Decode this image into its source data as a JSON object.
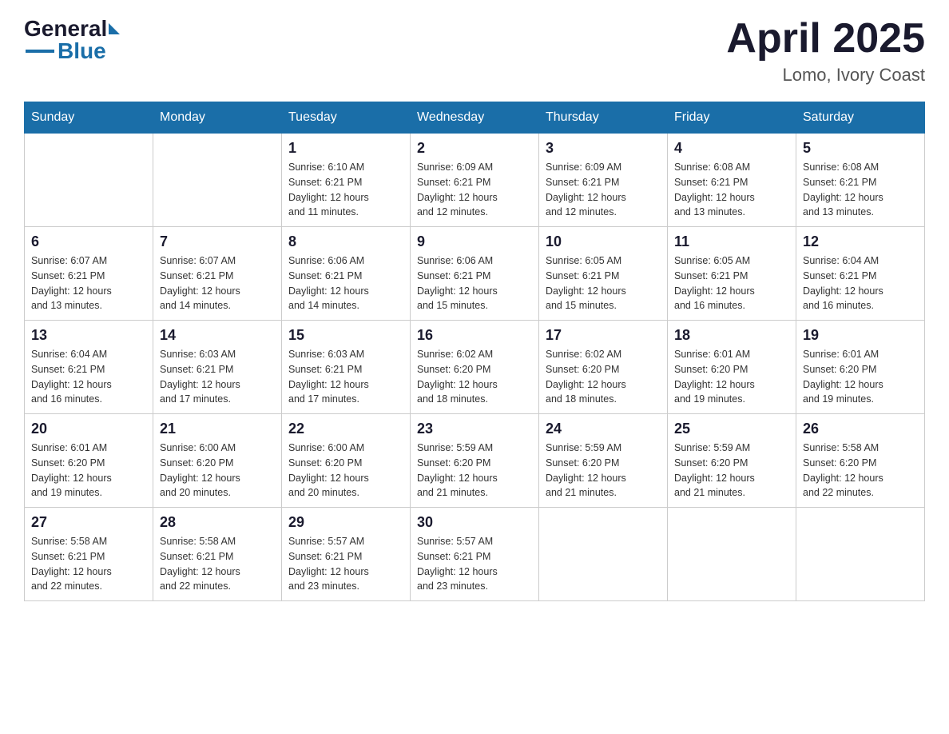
{
  "header": {
    "logo": {
      "general": "General",
      "blue": "Blue"
    },
    "title": "April 2025",
    "location": "Lomo, Ivory Coast"
  },
  "weekdays": [
    "Sunday",
    "Monday",
    "Tuesday",
    "Wednesday",
    "Thursday",
    "Friday",
    "Saturday"
  ],
  "weeks": [
    [
      {
        "day": "",
        "info": ""
      },
      {
        "day": "",
        "info": ""
      },
      {
        "day": "1",
        "info": "Sunrise: 6:10 AM\nSunset: 6:21 PM\nDaylight: 12 hours\nand 11 minutes."
      },
      {
        "day": "2",
        "info": "Sunrise: 6:09 AM\nSunset: 6:21 PM\nDaylight: 12 hours\nand 12 minutes."
      },
      {
        "day": "3",
        "info": "Sunrise: 6:09 AM\nSunset: 6:21 PM\nDaylight: 12 hours\nand 12 minutes."
      },
      {
        "day": "4",
        "info": "Sunrise: 6:08 AM\nSunset: 6:21 PM\nDaylight: 12 hours\nand 13 minutes."
      },
      {
        "day": "5",
        "info": "Sunrise: 6:08 AM\nSunset: 6:21 PM\nDaylight: 12 hours\nand 13 minutes."
      }
    ],
    [
      {
        "day": "6",
        "info": "Sunrise: 6:07 AM\nSunset: 6:21 PM\nDaylight: 12 hours\nand 13 minutes."
      },
      {
        "day": "7",
        "info": "Sunrise: 6:07 AM\nSunset: 6:21 PM\nDaylight: 12 hours\nand 14 minutes."
      },
      {
        "day": "8",
        "info": "Sunrise: 6:06 AM\nSunset: 6:21 PM\nDaylight: 12 hours\nand 14 minutes."
      },
      {
        "day": "9",
        "info": "Sunrise: 6:06 AM\nSunset: 6:21 PM\nDaylight: 12 hours\nand 15 minutes."
      },
      {
        "day": "10",
        "info": "Sunrise: 6:05 AM\nSunset: 6:21 PM\nDaylight: 12 hours\nand 15 minutes."
      },
      {
        "day": "11",
        "info": "Sunrise: 6:05 AM\nSunset: 6:21 PM\nDaylight: 12 hours\nand 16 minutes."
      },
      {
        "day": "12",
        "info": "Sunrise: 6:04 AM\nSunset: 6:21 PM\nDaylight: 12 hours\nand 16 minutes."
      }
    ],
    [
      {
        "day": "13",
        "info": "Sunrise: 6:04 AM\nSunset: 6:21 PM\nDaylight: 12 hours\nand 16 minutes."
      },
      {
        "day": "14",
        "info": "Sunrise: 6:03 AM\nSunset: 6:21 PM\nDaylight: 12 hours\nand 17 minutes."
      },
      {
        "day": "15",
        "info": "Sunrise: 6:03 AM\nSunset: 6:21 PM\nDaylight: 12 hours\nand 17 minutes."
      },
      {
        "day": "16",
        "info": "Sunrise: 6:02 AM\nSunset: 6:20 PM\nDaylight: 12 hours\nand 18 minutes."
      },
      {
        "day": "17",
        "info": "Sunrise: 6:02 AM\nSunset: 6:20 PM\nDaylight: 12 hours\nand 18 minutes."
      },
      {
        "day": "18",
        "info": "Sunrise: 6:01 AM\nSunset: 6:20 PM\nDaylight: 12 hours\nand 19 minutes."
      },
      {
        "day": "19",
        "info": "Sunrise: 6:01 AM\nSunset: 6:20 PM\nDaylight: 12 hours\nand 19 minutes."
      }
    ],
    [
      {
        "day": "20",
        "info": "Sunrise: 6:01 AM\nSunset: 6:20 PM\nDaylight: 12 hours\nand 19 minutes."
      },
      {
        "day": "21",
        "info": "Sunrise: 6:00 AM\nSunset: 6:20 PM\nDaylight: 12 hours\nand 20 minutes."
      },
      {
        "day": "22",
        "info": "Sunrise: 6:00 AM\nSunset: 6:20 PM\nDaylight: 12 hours\nand 20 minutes."
      },
      {
        "day": "23",
        "info": "Sunrise: 5:59 AM\nSunset: 6:20 PM\nDaylight: 12 hours\nand 21 minutes."
      },
      {
        "day": "24",
        "info": "Sunrise: 5:59 AM\nSunset: 6:20 PM\nDaylight: 12 hours\nand 21 minutes."
      },
      {
        "day": "25",
        "info": "Sunrise: 5:59 AM\nSunset: 6:20 PM\nDaylight: 12 hours\nand 21 minutes."
      },
      {
        "day": "26",
        "info": "Sunrise: 5:58 AM\nSunset: 6:20 PM\nDaylight: 12 hours\nand 22 minutes."
      }
    ],
    [
      {
        "day": "27",
        "info": "Sunrise: 5:58 AM\nSunset: 6:21 PM\nDaylight: 12 hours\nand 22 minutes."
      },
      {
        "day": "28",
        "info": "Sunrise: 5:58 AM\nSunset: 6:21 PM\nDaylight: 12 hours\nand 22 minutes."
      },
      {
        "day": "29",
        "info": "Sunrise: 5:57 AM\nSunset: 6:21 PM\nDaylight: 12 hours\nand 23 minutes."
      },
      {
        "day": "30",
        "info": "Sunrise: 5:57 AM\nSunset: 6:21 PM\nDaylight: 12 hours\nand 23 minutes."
      },
      {
        "day": "",
        "info": ""
      },
      {
        "day": "",
        "info": ""
      },
      {
        "day": "",
        "info": ""
      }
    ]
  ]
}
